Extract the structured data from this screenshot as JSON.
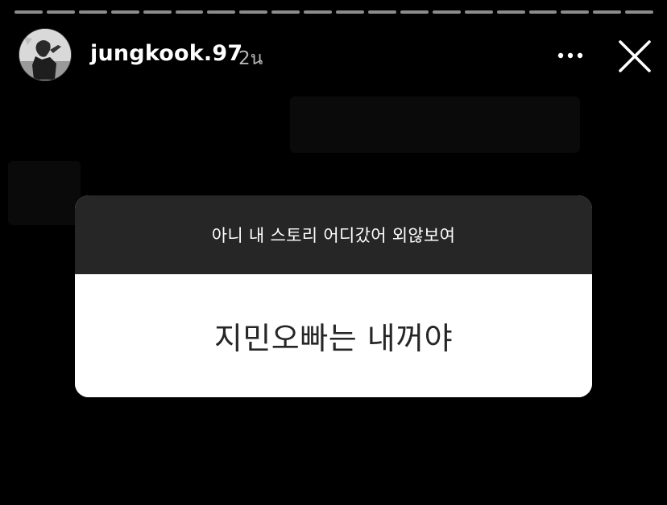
{
  "story": {
    "progress_segments": 20,
    "header": {
      "username": "jungkook.97",
      "timestamp": "2น",
      "avatar_icon": "profile-avatar",
      "more_icon": "more-horizontal-icon",
      "close_icon": "close-icon"
    },
    "question_sticker": {
      "prompt": "아니 내 스토리 어디갔어 외않보여",
      "answer": "지민오빠는 내꺼야",
      "header_color": "#262626",
      "body_color": "#ffffff"
    }
  }
}
